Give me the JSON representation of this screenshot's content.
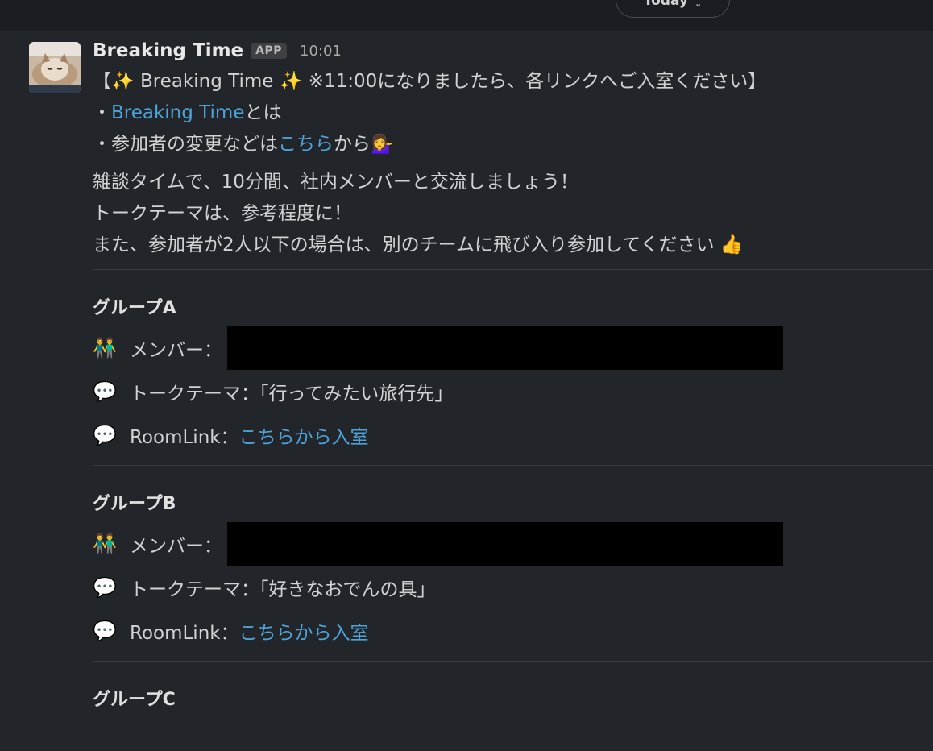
{
  "day_divider": {
    "label": "Today"
  },
  "message": {
    "sender": "Breaking Time",
    "badge": "APP",
    "time": "10:01",
    "announcement": {
      "open_bracket": "【",
      "sparkle_left": "✨",
      "title": " Breaking Time ",
      "sparkle_right": "✨",
      "notice": " ※11:00になりましたら、各リンクへご入室ください",
      "close_bracket": "】"
    },
    "bullet1": {
      "prefix": "・",
      "link": "Breaking Time",
      "suffix": "とは"
    },
    "bullet2": {
      "prefix": "・参加者の変更などは",
      "link": "こちら",
      "suffix": "から",
      "emoji": "💁‍♀️"
    },
    "para": [
      "雑談タイムで、10分間、社内メンバーと交流しましょう！",
      "トークテーマは、参考程度に！",
      "また、参加者が2人以下の場合は、別のチームに飛び入り参加してください "
    ],
    "thumbs_emoji": "👍",
    "groups": [
      {
        "title": "グループA",
        "member_icon": "👬",
        "member_label": " メンバー：",
        "theme_icon": "💬",
        "theme_text": " トークテーマ：「行ってみたい旅行先」",
        "room_icon": "💬",
        "room_label": " RoomLink：",
        "room_link": "こちらから入室"
      },
      {
        "title": "グループB",
        "member_icon": "👬",
        "member_label": " メンバー：",
        "theme_icon": "💬",
        "theme_text": " トークテーマ：「好きなおでんの具」",
        "room_icon": "💬",
        "room_label": " RoomLink：",
        "room_link": "こちらから入室"
      },
      {
        "title": "グループC"
      }
    ]
  }
}
